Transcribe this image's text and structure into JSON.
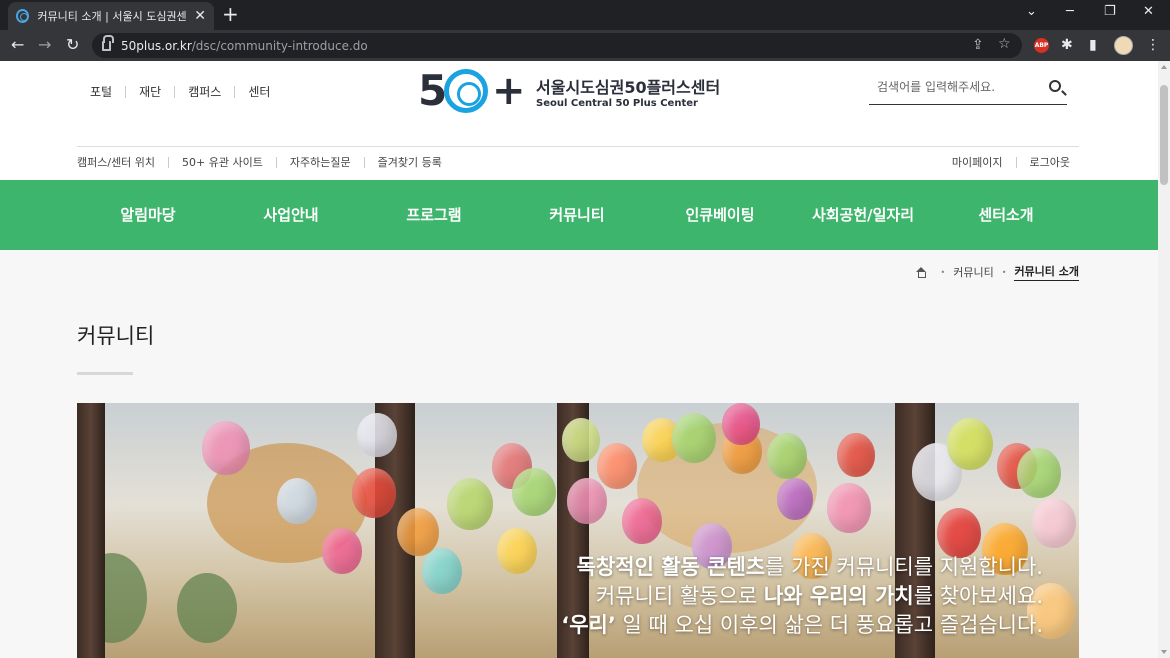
{
  "browser": {
    "tab_title": "커뮤니티 소개 | 서울시 도심권센",
    "tab_close": "✕",
    "new_tab": "+",
    "url_host": "50plus.or.kr",
    "url_path": "/dsc/community-introduce.do",
    "back": "←",
    "forward": "→",
    "reload": "↻",
    "minimize": "─",
    "restore": "❐",
    "close": "✕",
    "tab_menu": "⌄",
    "share": "⇪",
    "star": "☆",
    "abp": "ABP",
    "extensions": "✱",
    "sidepanel": "▮",
    "menu": "⋮"
  },
  "header": {
    "top_nav": [
      "포털",
      "재단",
      "캠퍼스",
      "센터"
    ],
    "logo": {
      "num": "5",
      "plus": "+",
      "name_ko": "서울시도심권50플러스센터",
      "name_en": "Seoul Central 50 Plus Center"
    },
    "search_placeholder": "검색어를 입력해주세요.",
    "util_left": [
      "캠퍼스/센터 위치",
      "50+ 유관 사이트",
      "자주하는질문",
      "즐겨찾기 등록"
    ],
    "util_right": [
      "마이페이지",
      "로그아웃"
    ]
  },
  "gnb": [
    "알림마당",
    "사업안내",
    "프로그램",
    "커뮤니티",
    "인큐베이팅",
    "사회공헌/일자리",
    "센터소개"
  ],
  "breadcrumb": {
    "items": [
      "커뮤니티",
      "커뮤니티 소개"
    ],
    "sep": "•"
  },
  "page_title": "커뮤니티",
  "hero": {
    "line1_bold": "독창적인 활동 콘텐츠",
    "line1_rest": "를 가진 커뮤니티를 지원합니다.",
    "line2_pre": "커뮤니티 활동으로 ",
    "line2_bold": "나와 우리의 가치",
    "line2_rest": "를 찾아보세요.",
    "line3_bold": "‘우리’",
    "line3_rest": " 일 때 오십 이후의 삶은 더 풍요롭고 즐겁습니다."
  }
}
